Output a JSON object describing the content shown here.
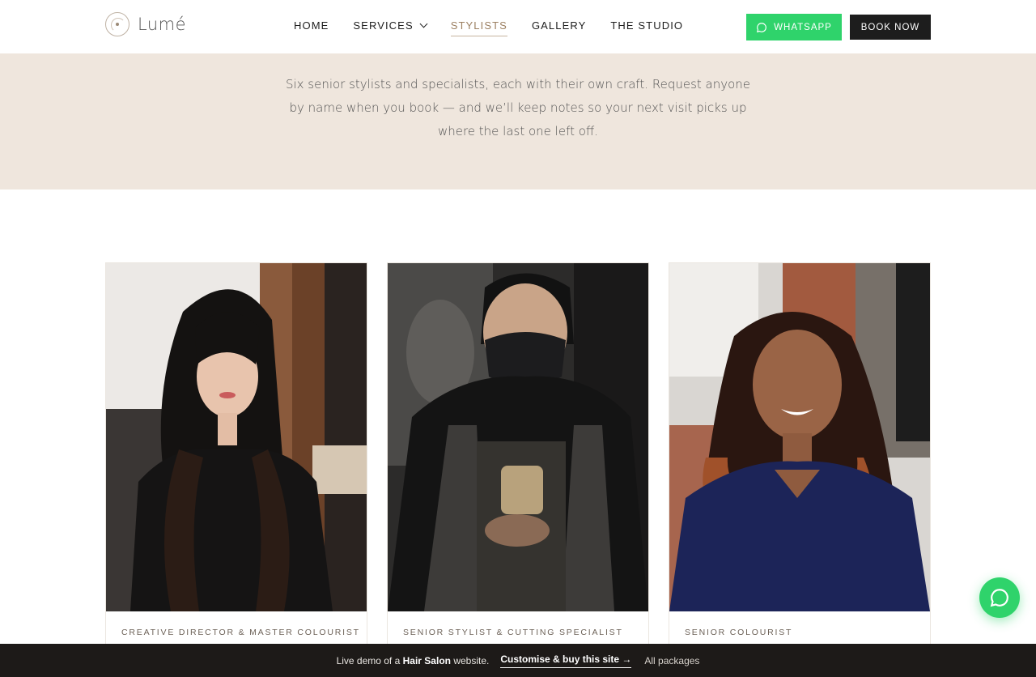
{
  "brand": {
    "name": "Lumé"
  },
  "nav": {
    "items": [
      {
        "label": "HOME"
      },
      {
        "label": "SERVICES"
      },
      {
        "label": "STYLISTS"
      },
      {
        "label": "GALLERY"
      },
      {
        "label": "THE STUDIO"
      }
    ],
    "active": "STYLISTS"
  },
  "header": {
    "whatsapp_label": "WHATSAPP",
    "book_label": "BOOK NOW"
  },
  "intro": {
    "text": "Six senior stylists and specialists, each with their own craft. Request anyone by name when you book — and we’ll keep notes so your next visit picks up where the last one left off."
  },
  "stylists": [
    {
      "role": "CREATIVE DIRECTOR & MASTER COLOURIST"
    },
    {
      "role": "SENIOR STYLIST & CUTTING SPECIALIST"
    },
    {
      "role": "SENIOR COLOURIST"
    }
  ],
  "demo_bar": {
    "prefix": "Live demo of a",
    "bold": "Hair Salon",
    "suffix": "website.",
    "cta": "Customise & buy this site →",
    "all": "All packages"
  },
  "colors": {
    "accent": "#2fd36b",
    "dark": "#1d1d1d",
    "beige": "#efe6dd",
    "nav_active": "#9c8062"
  }
}
